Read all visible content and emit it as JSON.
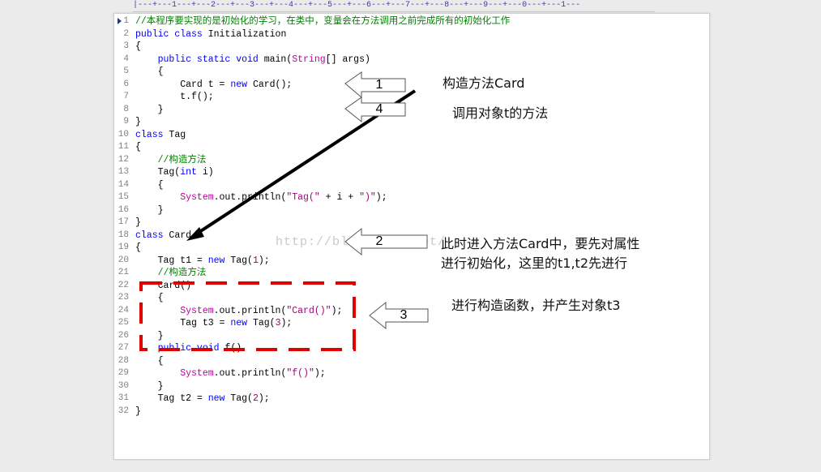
{
  "ruler": {
    "text": "|---+---1---+---2---+---3---+---4---+---5---+---6---+---7---+---8---+---9---+---0---+---1---"
  },
  "editor": {
    "lines": [
      {
        "n": "1",
        "tokens": [
          {
            "t": "//本程序要实现的是初始化的学习，在类中，变量会在方法调用之前完成所有的初始化工作",
            "c": "cm"
          }
        ]
      },
      {
        "n": "2",
        "tokens": [
          {
            "t": "public class",
            "c": "kw"
          },
          {
            "t": " Initialization",
            "c": ""
          }
        ]
      },
      {
        "n": "3",
        "tokens": [
          {
            "t": "{",
            "c": ""
          }
        ]
      },
      {
        "n": "4",
        "tokens": [
          {
            "t": "    public static void",
            "c": "kw"
          },
          {
            "t": " main(",
            "c": ""
          },
          {
            "t": "String",
            "c": "sys"
          },
          {
            "t": "[] args)",
            "c": ""
          }
        ]
      },
      {
        "n": "5",
        "tokens": [
          {
            "t": "    {",
            "c": ""
          }
        ]
      },
      {
        "n": "6",
        "tokens": [
          {
            "t": "        Card t = ",
            "c": ""
          },
          {
            "t": "new",
            "c": "kw"
          },
          {
            "t": " Card();",
            "c": ""
          }
        ]
      },
      {
        "n": "7",
        "tokens": [
          {
            "t": "        t.f();",
            "c": ""
          }
        ]
      },
      {
        "n": "8",
        "tokens": [
          {
            "t": "    }",
            "c": ""
          }
        ]
      },
      {
        "n": "9",
        "tokens": [
          {
            "t": "}",
            "c": ""
          }
        ]
      },
      {
        "n": "10",
        "tokens": [
          {
            "t": "class",
            "c": "kw"
          },
          {
            "t": " Tag",
            "c": ""
          }
        ]
      },
      {
        "n": "11",
        "tokens": [
          {
            "t": "{",
            "c": ""
          }
        ]
      },
      {
        "n": "12",
        "tokens": [
          {
            "t": "    //构造方法",
            "c": "cm"
          }
        ]
      },
      {
        "n": "13",
        "tokens": [
          {
            "t": "    Tag(",
            "c": ""
          },
          {
            "t": "int",
            "c": "kw"
          },
          {
            "t": " i)",
            "c": ""
          }
        ]
      },
      {
        "n": "14",
        "tokens": [
          {
            "t": "    {",
            "c": ""
          }
        ]
      },
      {
        "n": "15",
        "tokens": [
          {
            "t": "        System",
            "c": "sys"
          },
          {
            "t": ".out.println(",
            "c": ""
          },
          {
            "t": "\"Tag(\"",
            "c": "str"
          },
          {
            "t": " + i + ",
            "c": ""
          },
          {
            "t": "\")\"",
            "c": "str"
          },
          {
            "t": ");",
            "c": ""
          }
        ]
      },
      {
        "n": "16",
        "tokens": [
          {
            "t": "    }",
            "c": ""
          }
        ]
      },
      {
        "n": "17",
        "tokens": [
          {
            "t": "}",
            "c": ""
          }
        ]
      },
      {
        "n": "18",
        "tokens": [
          {
            "t": "class",
            "c": "kw"
          },
          {
            "t": " Card",
            "c": ""
          }
        ]
      },
      {
        "n": "19",
        "tokens": [
          {
            "t": "{",
            "c": ""
          }
        ]
      },
      {
        "n": "20",
        "tokens": [
          {
            "t": "    Tag t1 = ",
            "c": ""
          },
          {
            "t": "new",
            "c": "kw"
          },
          {
            "t": " Tag(",
            "c": ""
          },
          {
            "t": "1",
            "c": "num"
          },
          {
            "t": ");",
            "c": ""
          }
        ]
      },
      {
        "n": "21",
        "tokens": [
          {
            "t": "    //构造方法",
            "c": "cm"
          }
        ]
      },
      {
        "n": "22",
        "tokens": [
          {
            "t": "    Card()",
            "c": ""
          }
        ]
      },
      {
        "n": "23",
        "tokens": [
          {
            "t": "    {",
            "c": ""
          }
        ]
      },
      {
        "n": "24",
        "tokens": [
          {
            "t": "        System",
            "c": "sys"
          },
          {
            "t": ".out.println(",
            "c": ""
          },
          {
            "t": "\"Card()\"",
            "c": "str"
          },
          {
            "t": ");",
            "c": ""
          }
        ]
      },
      {
        "n": "25",
        "tokens": [
          {
            "t": "        Tag t3 = ",
            "c": ""
          },
          {
            "t": "new",
            "c": "kw"
          },
          {
            "t": " Tag(",
            "c": ""
          },
          {
            "t": "3",
            "c": "num"
          },
          {
            "t": ");",
            "c": ""
          }
        ]
      },
      {
        "n": "26",
        "tokens": [
          {
            "t": "    }",
            "c": ""
          }
        ]
      },
      {
        "n": "27",
        "tokens": [
          {
            "t": "    public void",
            "c": "kw"
          },
          {
            "t": " f()",
            "c": ""
          }
        ]
      },
      {
        "n": "28",
        "tokens": [
          {
            "t": "    {",
            "c": ""
          }
        ]
      },
      {
        "n": "29",
        "tokens": [
          {
            "t": "        System",
            "c": "sys"
          },
          {
            "t": ".out.println(",
            "c": ""
          },
          {
            "t": "\"f()\"",
            "c": "str"
          },
          {
            "t": ");",
            "c": ""
          }
        ]
      },
      {
        "n": "30",
        "tokens": [
          {
            "t": "    }",
            "c": ""
          }
        ]
      },
      {
        "n": "31",
        "tokens": [
          {
            "t": "    Tag t2 = ",
            "c": ""
          },
          {
            "t": "new",
            "c": "kw"
          },
          {
            "t": " Tag(",
            "c": ""
          },
          {
            "t": "2",
            "c": "num"
          },
          {
            "t": ");",
            "c": ""
          }
        ]
      },
      {
        "n": "32",
        "tokens": [
          {
            "t": "}",
            "c": ""
          }
        ]
      }
    ]
  },
  "callouts": [
    {
      "num": "1",
      "text": "构造方法Card"
    },
    {
      "num": "4",
      "text": "调用对象t的方法"
    },
    {
      "num": "2",
      "text": "此时进入方法Card中，要先对属性\n进行初始化，这里的t1,t2先进行"
    },
    {
      "num": "3",
      "text": "进行构造函数，并产生对象t3"
    }
  ],
  "watermark": "http://blog.csdn.net/",
  "colors": {
    "keyword": "#0000ff",
    "comment": "#008000",
    "system": "#c000a0",
    "highlight_box": "#e00000",
    "arrow": "#000000"
  }
}
